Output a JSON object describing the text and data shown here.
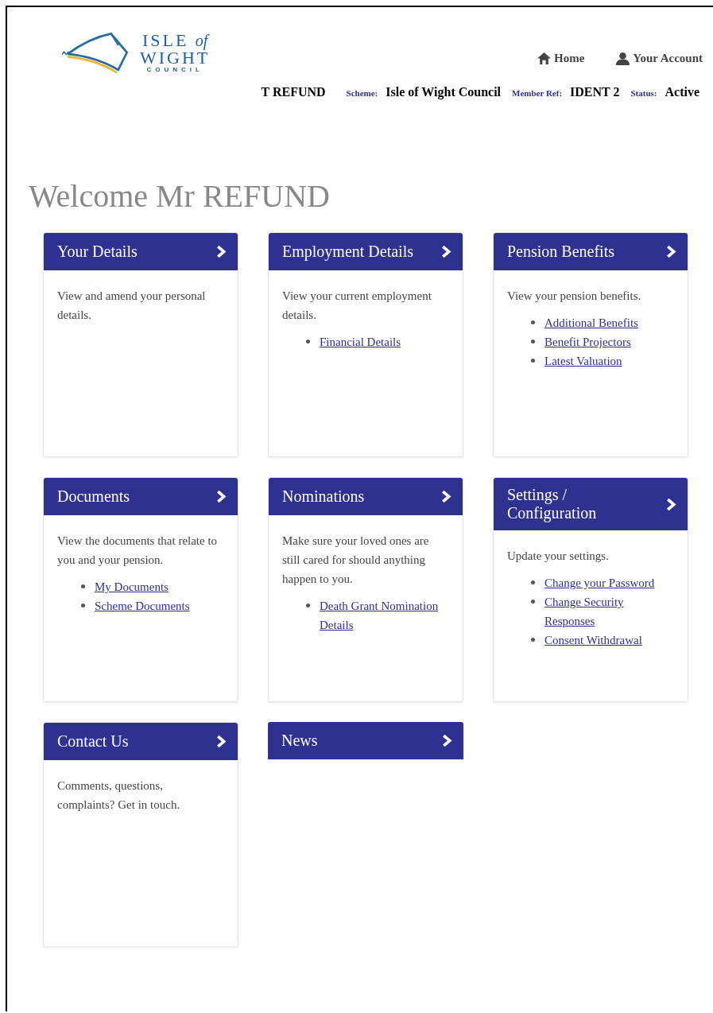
{
  "logo": {
    "line_1": "ISLE",
    "line_1_suffix": "of",
    "line_2": "WIGHT",
    "line_3": "COUNCIL"
  },
  "nav": [
    {
      "label": "Home",
      "kind": "home"
    },
    {
      "label": "Your Account",
      "kind": "account"
    }
  ],
  "member_bar": [
    {
      "kind": "value",
      "text": "T REFUND"
    },
    {
      "kind": "label",
      "text": "Scheme:"
    },
    {
      "kind": "value",
      "text": "Isle of Wight Council"
    },
    {
      "kind": "label",
      "text": "Member Ref:"
    },
    {
      "kind": "value",
      "text": "IDENT 2"
    },
    {
      "kind": "label",
      "text": "Status:"
    },
    {
      "kind": "value",
      "text": "Active"
    }
  ],
  "heading": "Welcome Mr REFUND",
  "cards": [
    {
      "title": "Your Details",
      "description": "View and amend your personal details."
    },
    {
      "title": "Employment Details",
      "description": "View your current employment details.",
      "links": [
        "Financial Details"
      ]
    },
    {
      "title": "Pension Benefits",
      "description": "View your pension benefits.",
      "links": [
        "Additional Benefits",
        "Benefit Projectors",
        "Latest Valuation"
      ]
    },
    {
      "title": "Documents",
      "description": "View the documents that relate to you and your pension.",
      "links": [
        "My Documents",
        "Scheme Documents"
      ]
    },
    {
      "title": "Nominations",
      "description": "Make sure your loved ones are still cared for should anything happen to you.",
      "links": [
        "Death Grant Nomination Details"
      ]
    },
    {
      "title": "Settings / Configuration",
      "description": "Update your settings.",
      "links": [
        "Change your Password",
        "Change Security Responses",
        "Consent Withdrawal"
      ]
    },
    {
      "title": "Contact Us",
      "description": "Comments, questions, complaints? Get in touch."
    },
    {
      "title": "News"
    }
  ]
}
